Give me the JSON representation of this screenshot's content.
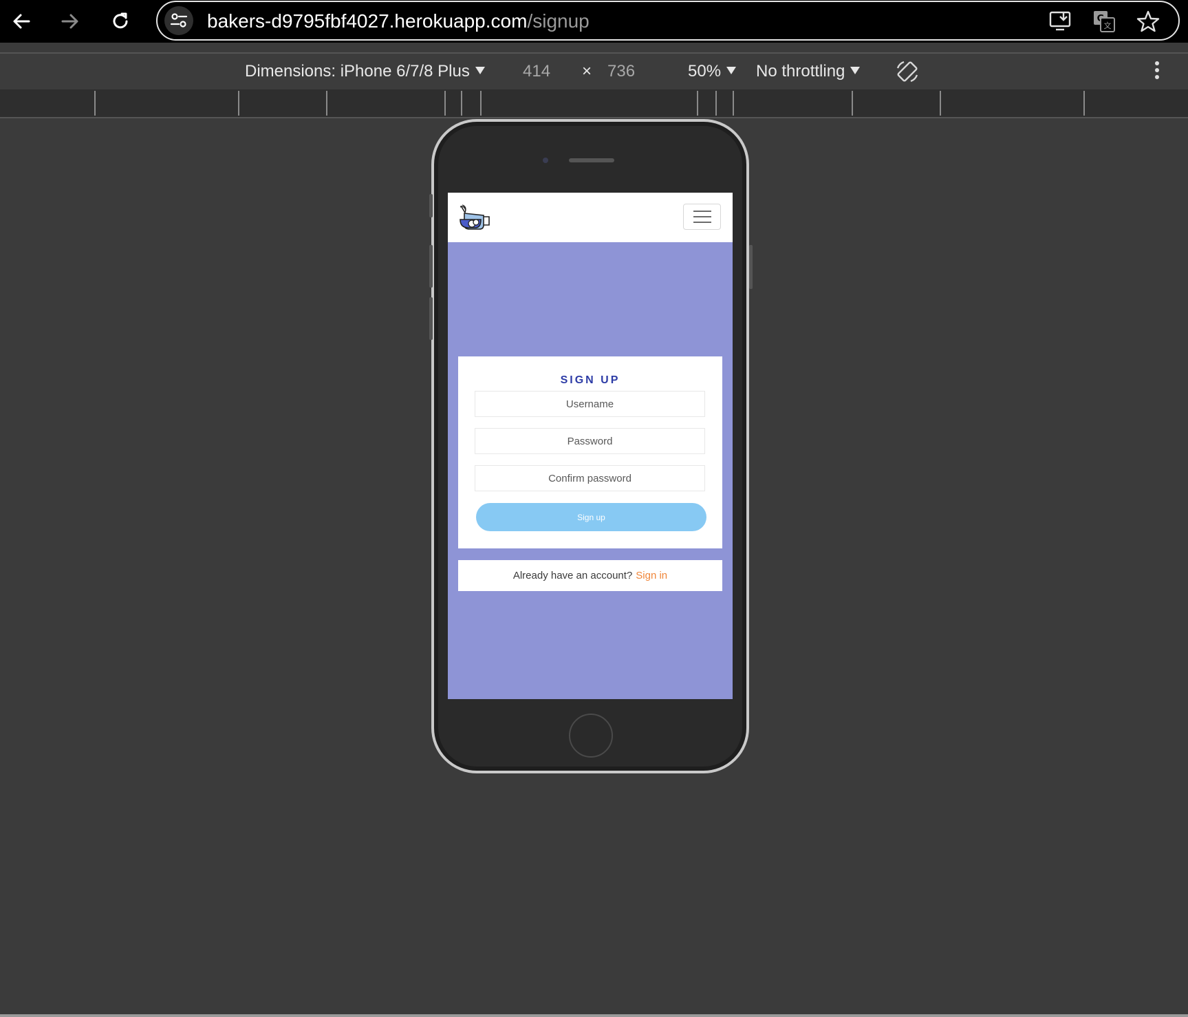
{
  "browser": {
    "url_host": "bakers-d9795fbf4027.herokuapp.com",
    "url_path": "/signup",
    "icons": {
      "back": "arrow-left-icon",
      "forward": "arrow-right-icon",
      "reload": "reload-icon",
      "site_info": "tune-icon",
      "install": "install-app-icon",
      "translate": "translate-icon",
      "bookmark": "star-icon"
    }
  },
  "device_toolbar": {
    "dimensions_label": "Dimensions: iPhone 6/7/8 Plus",
    "width": "414",
    "times": "×",
    "height": "736",
    "zoom": "50%",
    "throttling": "No throttling"
  },
  "site": {
    "logo": "baking-logo-icon",
    "menu": "hamburger-menu-icon",
    "signup": {
      "title": "SIGN UP",
      "username_placeholder": "Username",
      "password_placeholder": "Password",
      "confirm_placeholder": "Confirm password",
      "button_label": "Sign up"
    },
    "signin_prompt": "Already have an account?",
    "signin_link": "Sign in"
  },
  "colors": {
    "page_background": "#8e94d6",
    "title": "#2d3ca6",
    "button": "#87c9f3",
    "link": "#f0863a"
  }
}
